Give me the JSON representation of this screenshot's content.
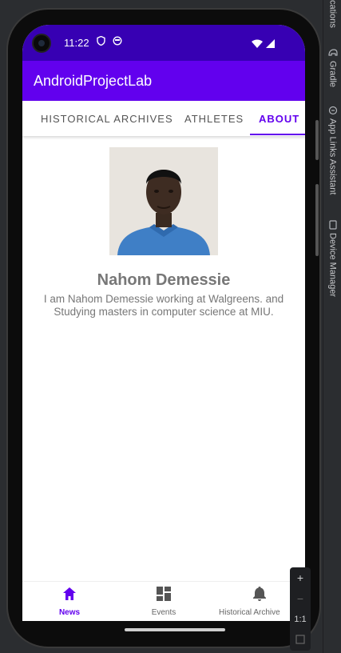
{
  "ide": {
    "tool_tabs": [
      {
        "label": "cations",
        "icon": "notifications-icon"
      },
      {
        "label": "Gradle",
        "icon": "elephant-icon"
      },
      {
        "label": "App Links Assistant",
        "icon": "link-icon"
      },
      {
        "label": "Device Manager",
        "icon": "device-icon"
      }
    ]
  },
  "statusbar": {
    "time": "11:22"
  },
  "appbar": {
    "title": "AndroidProjectLab"
  },
  "tabs": [
    {
      "label": "HISTORICAL ARCHIVES",
      "active": false
    },
    {
      "label": "ATHLETES",
      "active": false
    },
    {
      "label": "ABOUT",
      "active": true
    }
  ],
  "profile": {
    "name": "Nahom Demessie",
    "description": "I am Nahom Demessie working at Walgreens. and Studying masters in computer science at MIU."
  },
  "bottom_nav": [
    {
      "label": "News",
      "icon": "home-icon",
      "active": true
    },
    {
      "label": "Events",
      "icon": "dashboard-icon",
      "active": false
    },
    {
      "label": "Historical Archive",
      "icon": "bell-icon",
      "active": false
    }
  ],
  "zoom_controls": {
    "plus": "+",
    "minus": "−",
    "ratio": "1:1"
  },
  "colors": {
    "primary": "#6200ee",
    "primary_dark": "#3700b3",
    "text_muted": "#777777"
  }
}
